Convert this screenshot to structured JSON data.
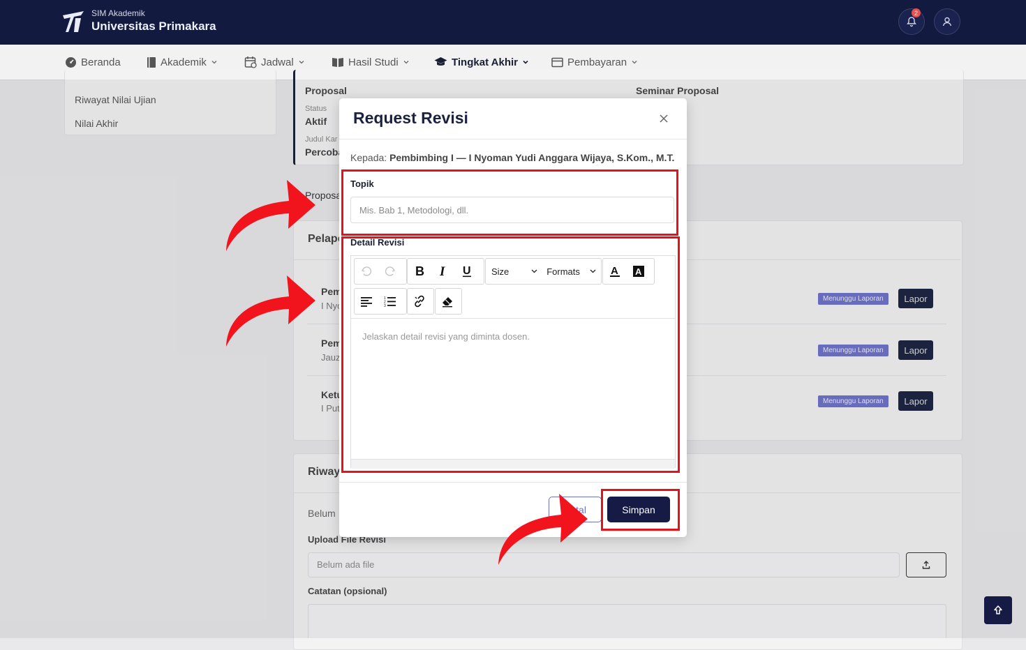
{
  "header": {
    "app_subtitle": "SIM Akademik",
    "app_title": "Universitas Primakara",
    "notification_count": "2"
  },
  "nav": {
    "items": [
      {
        "label": "Beranda",
        "icon": "dashboard-icon"
      },
      {
        "label": "Akademik",
        "icon": "book-icon"
      },
      {
        "label": "Jadwal",
        "icon": "calendar-icon"
      },
      {
        "label": "Hasil Studi",
        "icon": "open-book-icon"
      },
      {
        "label": "Tingkat Akhir",
        "icon": "graduation-cap-icon",
        "active": true
      },
      {
        "label": "Pembayaran",
        "icon": "payment-icon"
      }
    ]
  },
  "sidebar": {
    "items": [
      "Riwayat Nilai Ujian",
      "Nilai Akhir"
    ]
  },
  "info": {
    "tahapan_value": "Proposal",
    "detail_tahap_value": "Seminar Proposal",
    "status_label": "Status",
    "status_value": "Aktif",
    "judul_label": "Judul Kar",
    "judul_value": "Percoba"
  },
  "sections": {
    "proposal_tab": "Proposa",
    "pelapor_title": "Pelapo",
    "riwayat_title": "Riway",
    "belum_text": "Belum",
    "upload_label": "Upload File Revisi",
    "file_placeholder": "Belum ada file",
    "catatan_label": "Catatan (opsional)"
  },
  "examiners": [
    {
      "role": "Pem",
      "name": "I Nyo",
      "status": "Menunggu Laporan",
      "action": "Lapor"
    },
    {
      "role": "Pem",
      "name": "Jauz",
      "status": "Menunggu Laporan",
      "action": "Lapor"
    },
    {
      "role": "Ketu",
      "name": "I Put",
      "status": "Menunggu Laporan",
      "action": "Lapor"
    }
  ],
  "modal": {
    "title": "Request Revisi",
    "recipient_prefix": "Kepada:",
    "recipient_name": "Pembimbing I — I Nyoman Yudi Anggara Wijaya, S.Kom., M.T.",
    "topic_label": "Topik",
    "topic_placeholder": "Mis. Bab 1, Metodologi, dll.",
    "detail_label": "Detail Revisi",
    "size_label": "Size",
    "formats_label": "Formats",
    "editor_placeholder": "Jelaskan detail revisi yang diminta dosen.",
    "cancel_label": "Batal",
    "save_label": "Simpan"
  },
  "colors": {
    "primary": "#151b45",
    "highlight": "#e3121b",
    "badge": "#6e72c9"
  }
}
